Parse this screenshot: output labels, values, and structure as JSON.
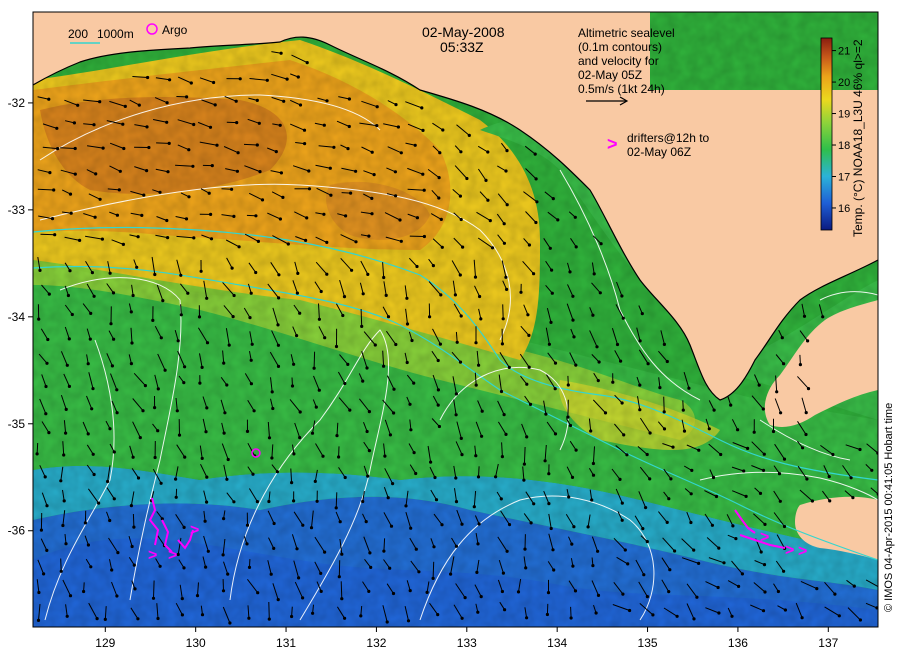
{
  "map": {
    "date": "02-May-2008",
    "time": "05:33Z",
    "isobath_legend": {
      "label_200": "200",
      "label_1000": "1000m"
    },
    "argo_label": "Argo",
    "altimetry_note": [
      "Altimetric sealevel",
      "(0.1m contours)",
      "and velocity for",
      "02-May 05Z",
      "0.5m/s (1kt 24h)"
    ],
    "drifters_note": [
      "drifters@12h to",
      "02-May 06Z"
    ],
    "drifter_symbol": ">",
    "colorbar": {
      "label": "Temp. (°C) NOAA18_L3U 46% ql>=2",
      "ticks": [
        "16",
        "17",
        "18",
        "19",
        "20",
        "21"
      ],
      "min": 15.3,
      "max": 21.4
    },
    "credit": "© IMOS 04-Apr-2015 00:41:05 Hobart time",
    "x_axis": {
      "ticks": [
        "129",
        "130",
        "131",
        "132",
        "133",
        "134",
        "135",
        "136",
        "137"
      ],
      "range": [
        128.2,
        137.55
      ]
    },
    "y_axis": {
      "ticks": [
        "-32",
        "-33",
        "-34",
        "-35",
        "-36"
      ],
      "range": [
        -36.9,
        -31.15
      ]
    },
    "colors": {
      "land": "#f9c9a3",
      "contour": "#ffffff",
      "isobath": "#33d6cf",
      "drifter": "#ff00ff",
      "arrow": "#000000"
    }
  }
}
